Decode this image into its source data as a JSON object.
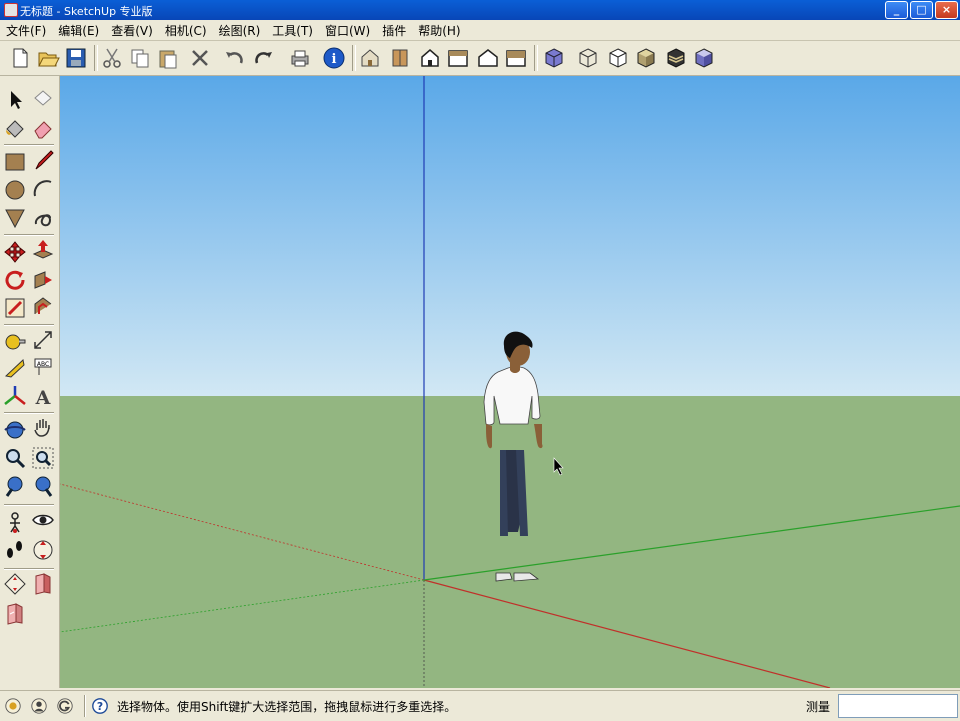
{
  "window": {
    "title": "无标题 - SketchUp 专业版",
    "buttons": [
      "_",
      "□",
      "×"
    ]
  },
  "menubar": {
    "items": [
      "文件(F)",
      "编辑(E)",
      "查看(V)",
      "相机(C)",
      "绘图(R)",
      "工具(T)",
      "窗口(W)",
      "插件",
      "帮助(H)"
    ]
  },
  "toolbar": {
    "icons": [
      "new-icon",
      "open-icon",
      "save-icon",
      "cut-icon",
      "copy-icon",
      "paste-icon",
      "erase-icon",
      "undo-icon",
      "redo-icon",
      "print-icon",
      "model-info-icon",
      "iso-view-icon",
      "top-view-icon",
      "front-view-icon",
      "right-view-icon",
      "back-view-icon",
      "left-view-icon",
      "xray-style-icon",
      "wireframe-style-icon",
      "hidden-line-style-icon",
      "shaded-style-icon",
      "shaded-textures-style-icon",
      "monochrome-style-icon"
    ]
  },
  "palette": {
    "icons": [
      "select-icon",
      "make-component-icon",
      "paint-bucket-icon",
      "eraser-icon",
      "rectangle-icon",
      "line-icon",
      "circle-icon",
      "arc-icon",
      "polygon-icon",
      "freehand-icon",
      "move-icon",
      "push-pull-icon",
      "rotate-icon",
      "follow-me-icon",
      "scale-icon",
      "offset-icon",
      "tape-measure-icon",
      "dimension-icon",
      "protractor-icon",
      "text-icon",
      "axes-icon",
      "3d-text-icon",
      "orbit-icon",
      "pan-icon",
      "zoom-icon",
      "zoom-window-icon",
      "previous-view-icon",
      "next-view-icon",
      "position-camera-icon",
      "look-around-icon",
      "walk-icon",
      "section-plane-icon",
      "sandbox-icon",
      "component-icon",
      "warehouse-icon"
    ]
  },
  "statusbar": {
    "icons": [
      "geo-location-icon",
      "credits-icon",
      "google-signin-icon"
    ],
    "help_icon": "?",
    "hint": "选择物体。使用Shift键扩大选择范围，拖拽鼠标进行多重选择。",
    "measure_label": "测量",
    "measure_value": ""
  },
  "colors": {
    "sky_top": "#5aa8e8",
    "sky_bottom": "#d2e8f4",
    "ground": "#93b681",
    "axis_red": "#c0302a",
    "axis_green": "#2aa02a",
    "axis_blue": "#1f3cb4"
  }
}
